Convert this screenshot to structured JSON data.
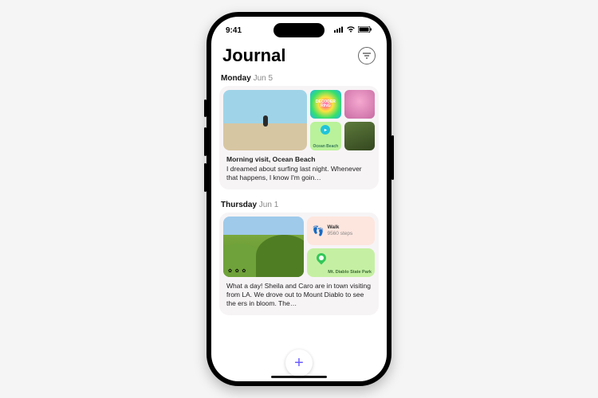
{
  "status": {
    "time": "9:41"
  },
  "header": {
    "title": "Journal"
  },
  "entries": [
    {
      "day": "Monday",
      "date": "Jun 5",
      "tiles": {
        "podcast": "DECODER RING",
        "map_label": "Ocean Beach"
      },
      "title": "Morning visit, Ocean Beach",
      "body": "I dreamed about surfing last night. Whenever that happens, I know I'm goin…"
    },
    {
      "day": "Thursday",
      "date": "Jun 1",
      "walk": {
        "label": "Walk",
        "steps": "9560 steps"
      },
      "map_label": "Mt. Diablo State Park",
      "body": "What a day! Sheila and Caro are in town visiting from LA. We drove out to Mount Diablo to see the ers in bloom. The…"
    }
  ]
}
